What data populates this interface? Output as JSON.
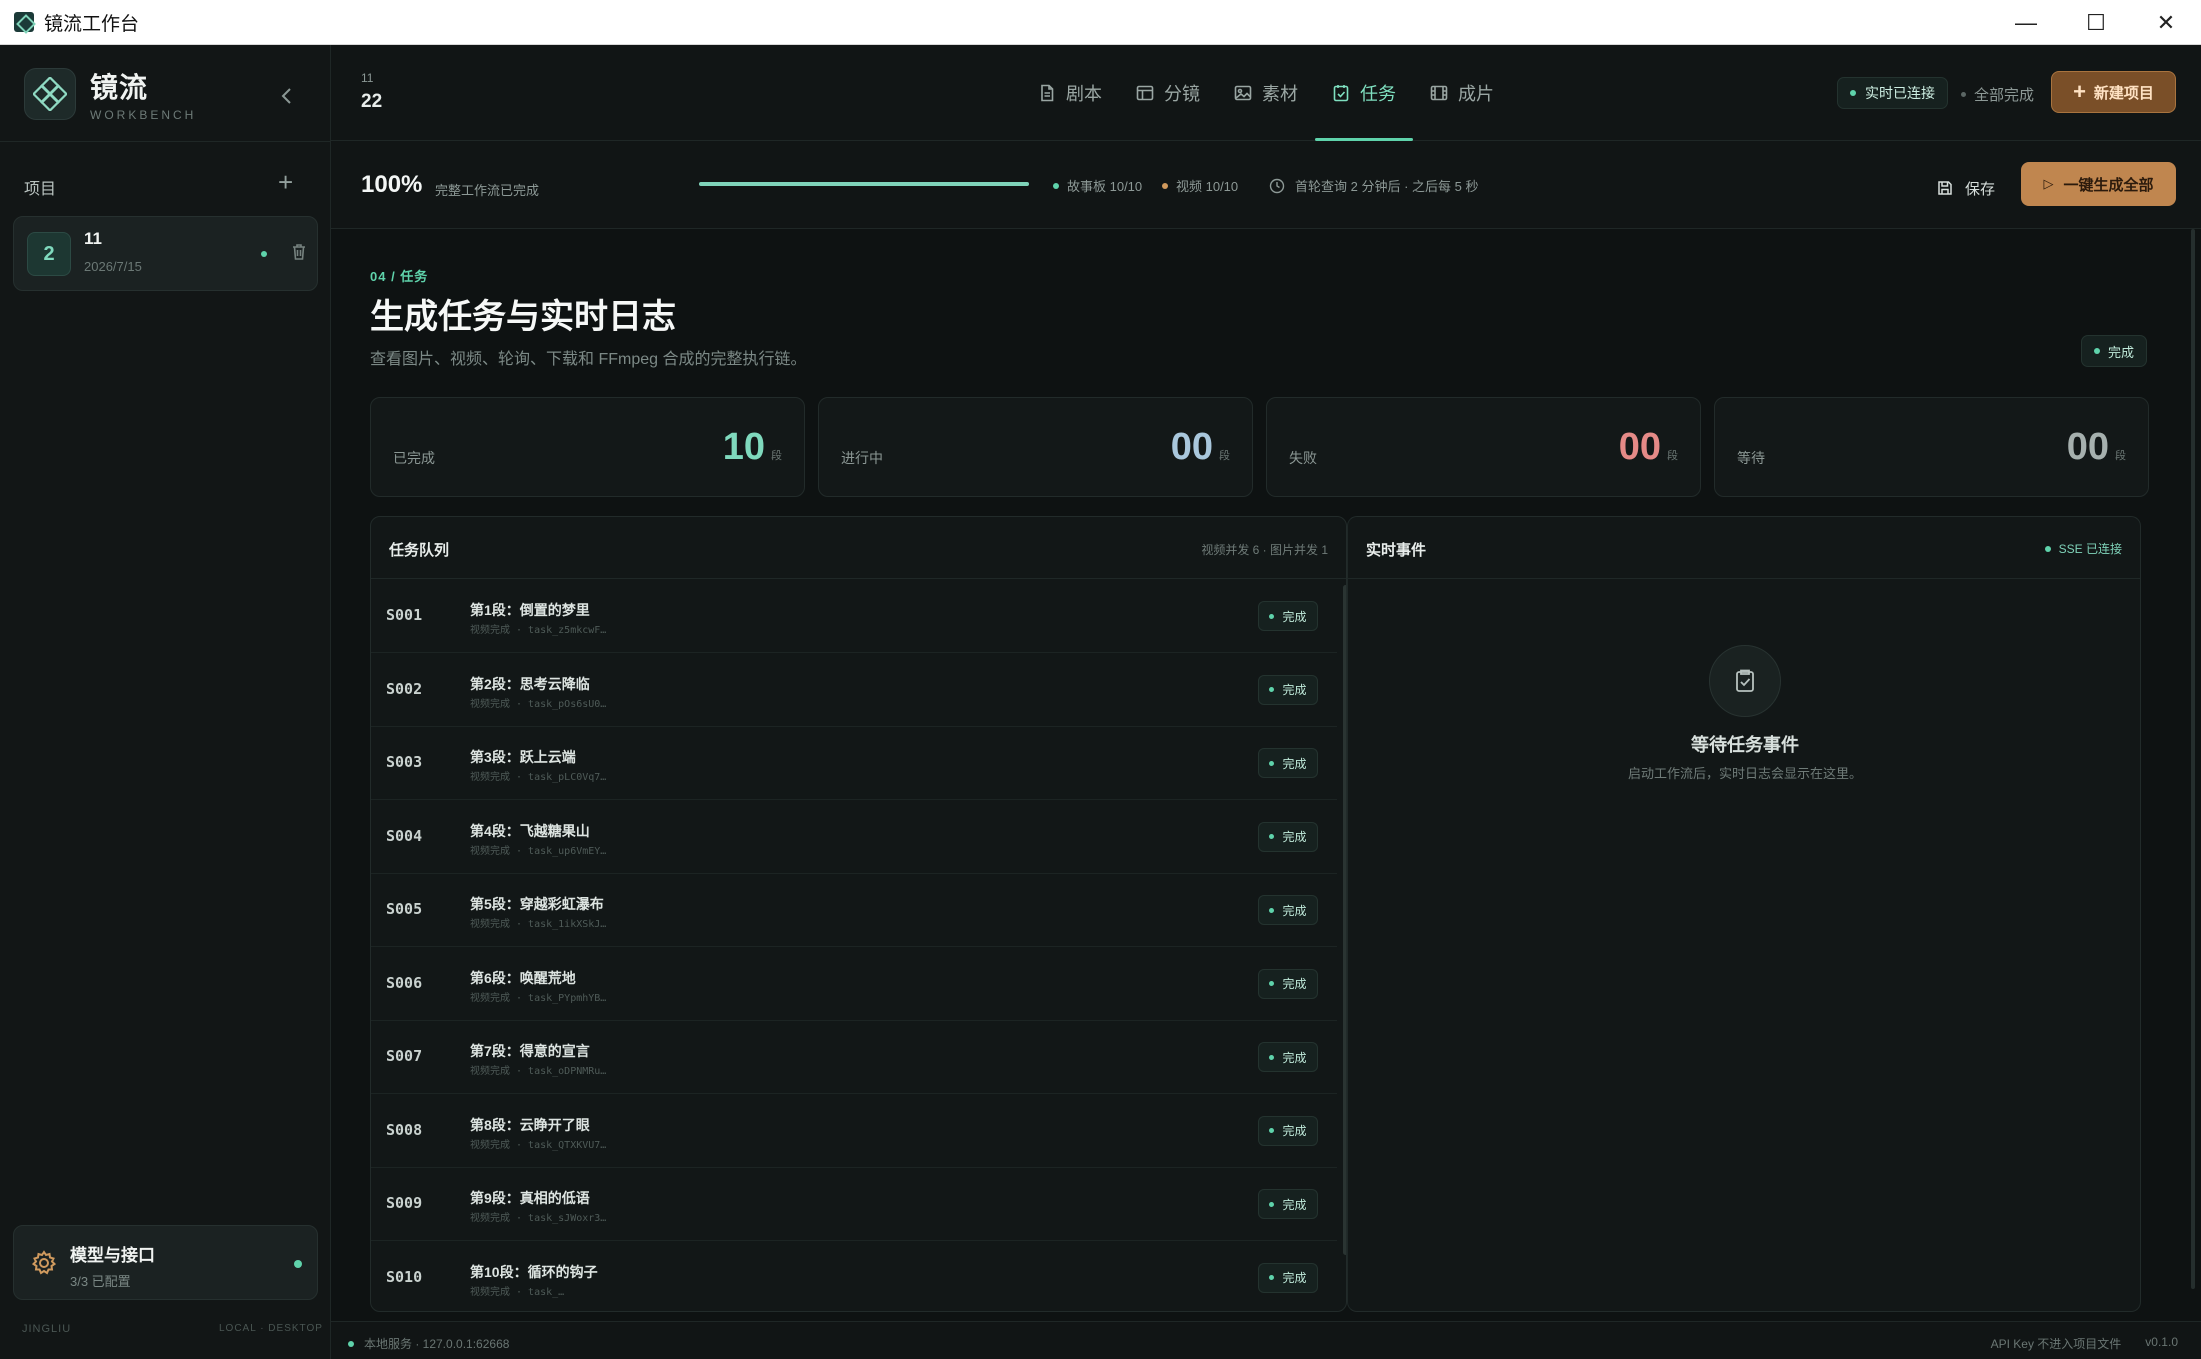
{
  "window": {
    "title": "镜流工作台",
    "minimize": "—",
    "maximize": "☐",
    "close": "✕"
  },
  "sidebar": {
    "brand_name": "镜流",
    "brand_sub": "WORKBENCH",
    "section_label": "项目",
    "add": "+",
    "project": {
      "number": "2",
      "name": "11",
      "date": "2026/7/15"
    },
    "model": {
      "title": "模型与接口",
      "subtitle": "3/3 已配置"
    },
    "footer_left": "JINGLIU",
    "footer_right": "LOCAL · DESKTOP"
  },
  "header": {
    "project_small": "11",
    "project_big": "22",
    "tabs": [
      {
        "label": "剧本",
        "icon": "document-icon"
      },
      {
        "label": "分镜",
        "icon": "layout-icon"
      },
      {
        "label": "素材",
        "icon": "image-icon"
      },
      {
        "label": "任务",
        "icon": "checklist-icon",
        "active": true
      },
      {
        "label": "成片",
        "icon": "film-icon"
      }
    ],
    "live_status": "实时已连接",
    "all_done": "全部完成",
    "new_project": "新建项目"
  },
  "progress": {
    "percent_text": "100%",
    "percent": 1.0,
    "subtitle": "完整工作流已完成",
    "storyboard": "故事板 10/10",
    "video": "视频 10/10",
    "polling": "首轮查询 2 分钟后 · 之后每 5 秒",
    "save": "保存",
    "generate_all": "一键生成全部"
  },
  "main": {
    "tag": "04 / 任务",
    "title": "生成任务与实时日志",
    "description": "查看图片、视频、轮询、下载和 FFmpeg 合成的完整执行链。",
    "status": "完成",
    "stats": [
      {
        "label": "已完成",
        "value": "10",
        "unit": "段",
        "color": "#7fd9bd"
      },
      {
        "label": "进行中",
        "value": "00",
        "unit": "段",
        "color": "#a9c7dc"
      },
      {
        "label": "失败",
        "value": "00",
        "unit": "段",
        "color": "#e58a87"
      },
      {
        "label": "等待",
        "value": "00",
        "unit": "段",
        "color": "#a6b0ae"
      }
    ],
    "queue": {
      "title": "任务队列",
      "note": "视频并发 6 · 图片并发 1",
      "tasks": [
        {
          "id": "S001",
          "name": "第1段：倒置的梦里",
          "sub": "视频完成 · task_z5mkcwF…",
          "status": "完成"
        },
        {
          "id": "S002",
          "name": "第2段：思考云降临",
          "sub": "视频完成 · task_pOs6sU0…",
          "status": "完成"
        },
        {
          "id": "S003",
          "name": "第3段：跃上云端",
          "sub": "视频完成 · task_pLC0Vq7…",
          "status": "完成"
        },
        {
          "id": "S004",
          "name": "第4段：飞越糖果山",
          "sub": "视频完成 · task_up6VmEY…",
          "status": "完成"
        },
        {
          "id": "S005",
          "name": "第5段：穿越彩虹瀑布",
          "sub": "视频完成 · task_1ikXSkJ…",
          "status": "完成"
        },
        {
          "id": "S006",
          "name": "第6段：唤醒荒地",
          "sub": "视频完成 · task_PYpmhYB…",
          "status": "完成"
        },
        {
          "id": "S007",
          "name": "第7段：得意的宣言",
          "sub": "视频完成 · task_oDPNMRu…",
          "status": "完成"
        },
        {
          "id": "S008",
          "name": "第8段：云睁开了眼",
          "sub": "视频完成 · task_QTXKVU7…",
          "status": "完成"
        },
        {
          "id": "S009",
          "name": "第9段：真相的低语",
          "sub": "视频完成 · task_sJWoxr3…",
          "status": "完成"
        },
        {
          "id": "S010",
          "name": "第10段：循环的钩子",
          "sub": "视频完成 · task_…",
          "status": "完成"
        }
      ]
    },
    "events": {
      "title": "实时事件",
      "sse": "SSE 已连接",
      "empty_title": "等待任务事件",
      "empty_desc": "启动工作流后，实时日志会显示在这里。"
    }
  },
  "footer": {
    "service": "本地服务 · 127.0.0.1:62668",
    "api_note": "API Key 不进入项目文件",
    "version": "v0.1.0"
  },
  "colors": {
    "accent": "#5fd3ab",
    "warm": "#c0864f",
    "background": "#0e1212"
  }
}
